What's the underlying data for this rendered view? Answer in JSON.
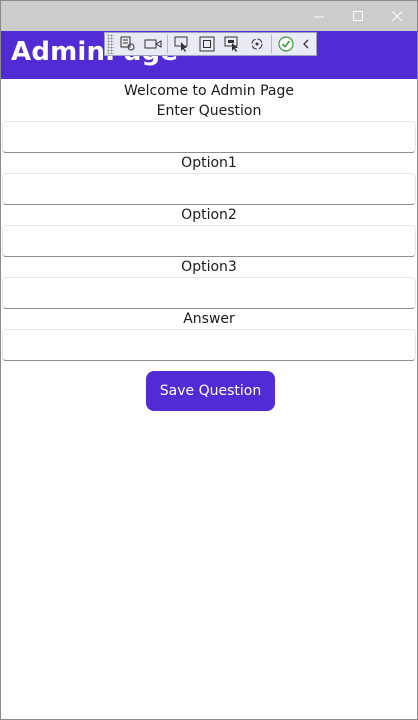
{
  "window": {
    "caption_minimize": "—",
    "caption_maximize": "☐",
    "caption_close": "✕"
  },
  "appbar": {
    "title": "AdminPage"
  },
  "debug_toolbar": {
    "icons": [
      "live-visual-tree-icon",
      "record-icon",
      "select-element-icon",
      "display-layout-adorners-icon",
      "track-focus-icon",
      "hot-reload-icon",
      "checkmark-icon",
      "collapse-chevron-icon"
    ]
  },
  "form": {
    "welcome": "Welcome to Admin Page",
    "question_label": "Enter Question",
    "question_value": "",
    "option1_label": "Option1",
    "option1_value": "",
    "option2_label": "Option2",
    "option2_value": "",
    "option3_label": "Option3",
    "option3_value": "",
    "answer_label": "Answer",
    "answer_value": "",
    "save_label": "Save Question"
  },
  "colors": {
    "accent": "#512bd4",
    "titlebar": "#cccccc"
  }
}
